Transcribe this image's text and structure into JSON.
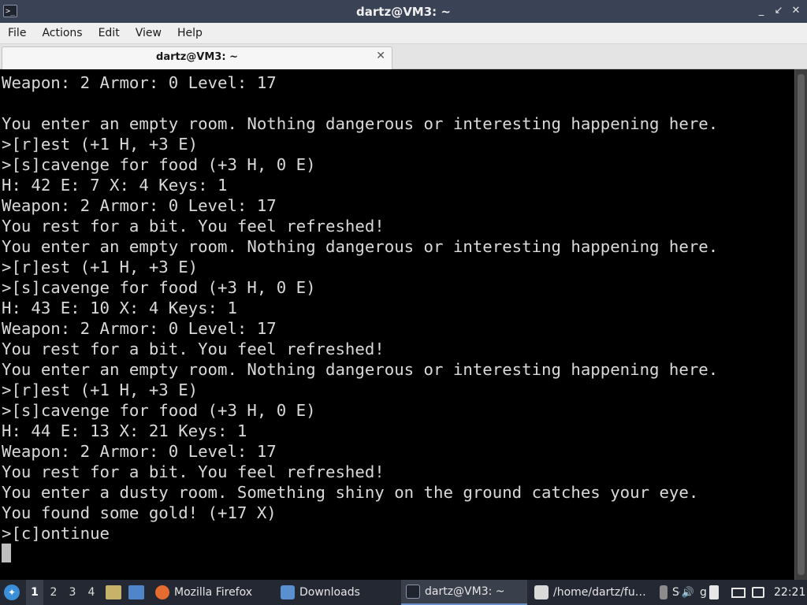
{
  "window": {
    "title": "dartz@VM3: ~",
    "app_icon": "terminal-icon",
    "controls": {
      "minimize": "_",
      "maximize": "↙",
      "close": "✕"
    }
  },
  "menu": [
    "File",
    "Actions",
    "Edit",
    "View",
    "Help"
  ],
  "tab": {
    "label": "dartz@VM3: ~",
    "close": "✕"
  },
  "terminal": {
    "lines": [
      "Weapon: 2 Armor: 0 Level: 17",
      "",
      "You enter an empty room. Nothing dangerous or interesting happening here.",
      ">[r]est (+1 H, +3 E)",
      ">[s]cavenge for food (+3 H, 0 E)",
      "H: 42 E: 7 X: 4 Keys: 1",
      "Weapon: 2 Armor: 0 Level: 17",
      "You rest for a bit. You feel refreshed!",
      "You enter an empty room. Nothing dangerous or interesting happening here.",
      ">[r]est (+1 H, +3 E)",
      ">[s]cavenge for food (+3 H, 0 E)",
      "H: 43 E: 10 X: 4 Keys: 1",
      "Weapon: 2 Armor: 0 Level: 17",
      "You rest for a bit. You feel refreshed!",
      "You enter an empty room. Nothing dangerous or interesting happening here.",
      ">[r]est (+1 H, +3 E)",
      ">[s]cavenge for food (+3 H, 0 E)",
      "H: 44 E: 13 X: 21 Keys: 1",
      "Weapon: 2 Armor: 0 Level: 17",
      "You rest for a bit. You feel refreshed!",
      "You enter a dusty room. Something shiny on the ground catches your eye.",
      "You found some gold! (+17 X)",
      ">[c]ontinue"
    ]
  },
  "taskbar": {
    "workspaces": [
      "1",
      "2",
      "3",
      "4"
    ],
    "windows": [
      {
        "label": "Mozilla Firefox",
        "icon": "firefox-icon"
      },
      {
        "label": "Downloads",
        "icon": "folder-icon"
      },
      {
        "label": "dartz@VM3: ~",
        "icon": "terminal-icon"
      },
      {
        "label": "/home/dartz/fu…",
        "icon": "text-editor-icon"
      },
      {
        "label": "Se",
        "icon": "settings-icon"
      }
    ],
    "tray_partial_label": "g",
    "clock": "22:21"
  },
  "colors": {
    "titlebar": "#3a4255",
    "terminal_bg": "#000000",
    "terminal_fg": "#d9d9d9",
    "taskbar": "#242832"
  }
}
